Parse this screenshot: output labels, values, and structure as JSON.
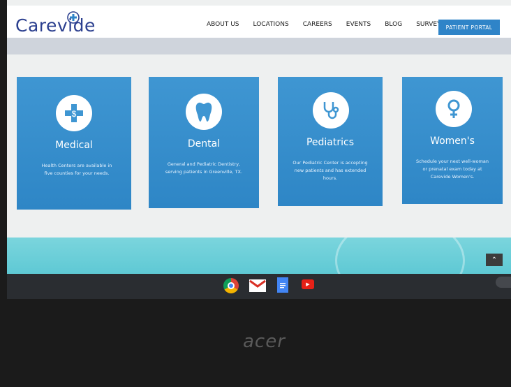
{
  "header": {
    "logo_text": "Care",
    "logo_text2": "vide",
    "nav": [
      "ABOUT US",
      "LOCATIONS",
      "CAREERS",
      "EVENTS",
      "BLOG",
      "SURVEYS"
    ],
    "portal_button": "PATIENT PORTAL"
  },
  "cards": [
    {
      "title": "Medical",
      "desc": "Health Centers are available in five counties for your needs.",
      "icon": "medical-dollar-icon"
    },
    {
      "title": "Dental",
      "desc": "General and Pediatric Dentistry, serving patients in Greenville, TX.",
      "icon": "tooth-icon"
    },
    {
      "title": "Pediatrics",
      "desc": "Our Pediatric Center is accepting new patients and has extended hours.",
      "icon": "stethoscope-icon"
    },
    {
      "title": "Women's",
      "desc": "Schedule your next well-woman or prenatal exam today at Carevide Women's.",
      "icon": "female-symbol-icon"
    }
  ],
  "scroll_top_icon": "chevron-up-icon",
  "taskbar": {
    "apps": [
      "chrome-icon",
      "gmail-icon",
      "docs-icon",
      "youtube-icon"
    ]
  },
  "laptop_brand": "acer"
}
